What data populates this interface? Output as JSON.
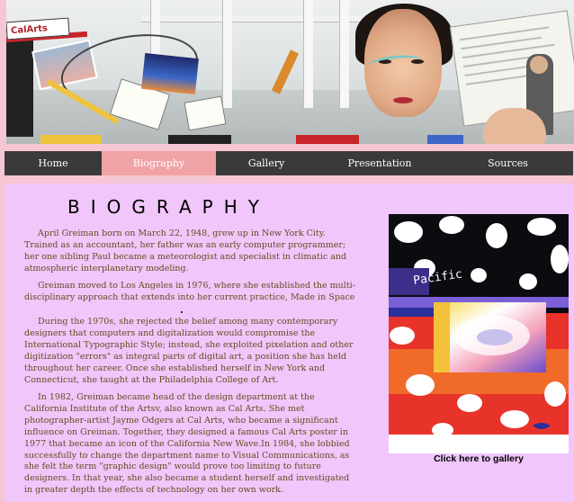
{
  "banner": {
    "logo_text": "CalArts",
    "colors": {
      "red": "#c9242b",
      "yellow": "#f0c33c",
      "sky": "#3c67c8"
    }
  },
  "nav": {
    "items": [
      {
        "label": "Home"
      },
      {
        "label": "Biography",
        "active": true
      },
      {
        "label": "Gallery"
      },
      {
        "label": "Presentation"
      },
      {
        "label": "Sources"
      }
    ],
    "colors": {
      "bar": "#3a3a3a",
      "active": "#f1a2a5",
      "text": "#ffffff"
    }
  },
  "main": {
    "title": "BIOGRAPHY",
    "paragraphs": [
      "April Greiman born on March 22, 1948, grew up in New York City. Trained as an accountant, her father was an early computer programmer; her one sibling Paul became a meteorologist and specialist in climatic and atmospheric interplanetary modeling.",
      "Greiman moved to Los Angeles in 1976, where she established the multi-disciplinary approach that extends into her current practice, Made in Space",
      "During the 1970s, she rejected the belief among many contemporary designers that computers and digitalization would compromise the International Typographic Style; instead, she exploited pixelation and other digitization \"errors\" as integral parts of digital art, a position she has held throughout her career. Once she established herself in New York and Connecticut, she taught at the Philadelphia College of Art.",
      "In 1982, Greiman became head of the design department at the California Institute of the Artsv, also known as Cal Arts. She met photographer-artist Jayme Odgers at Cal Arts, who became a significant influence on Greiman. Together, they designed a famous Cal Arts poster in 1977 that became an icon of the California New Wave.In 1984, she lobbied successfully to change the department name to Visual Communications, as she felt the term \"graphic design\" would prove too limiting to future designers. In that year, she also became a student herself and investigated in greater depth the effects of technology on her own work."
    ],
    "colors": {
      "background": "#f0c6fb",
      "text": "#5f4e1d"
    }
  },
  "gallery": {
    "poster_text": "Pacific",
    "link_label": "Click here to gallery"
  }
}
